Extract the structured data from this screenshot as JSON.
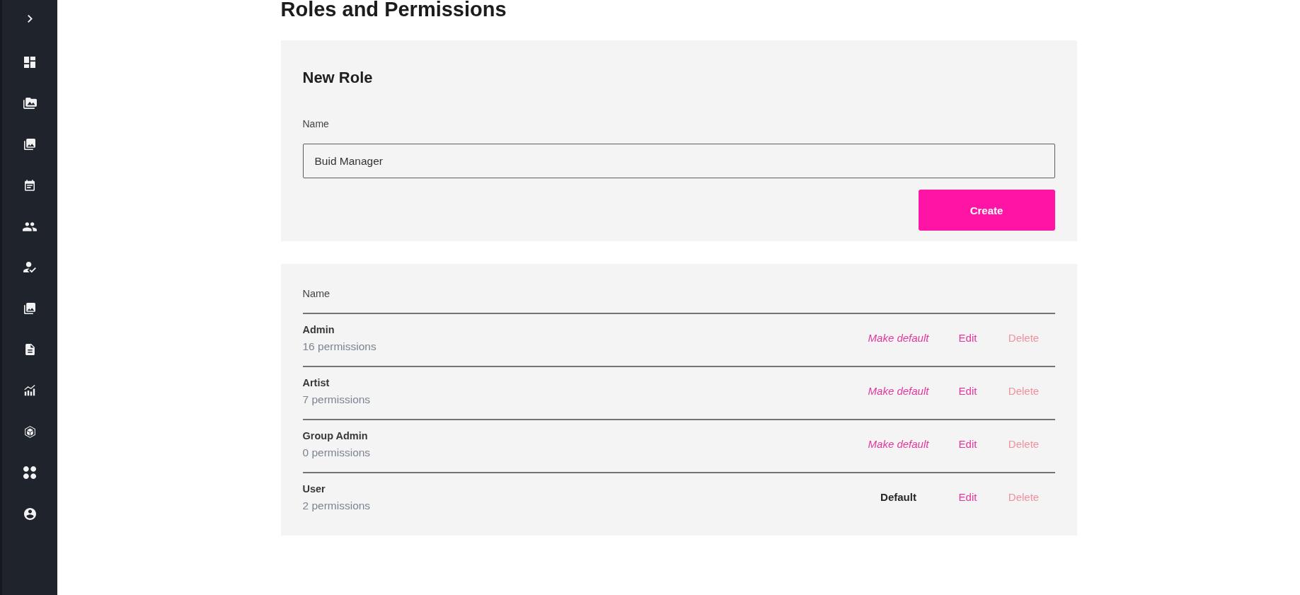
{
  "page": {
    "title": "Roles and Permissions"
  },
  "new_role": {
    "title": "New Role",
    "name_label": "Name",
    "name_value": "Buid Manager",
    "create_button": "Create"
  },
  "roles_table": {
    "columns": [
      "Name"
    ],
    "rows": [
      {
        "name": "Admin",
        "permissions": "16 permissions",
        "default": false,
        "default_text": "Make default",
        "actions": [
          {
            "kind": "edit",
            "label": "Edit"
          },
          {
            "kind": "delete",
            "label": "Delete"
          }
        ]
      },
      {
        "name": "Artist",
        "permissions": "7 permissions",
        "default": false,
        "default_text": "Make default",
        "actions": [
          {
            "kind": "edit",
            "label": "Edit"
          },
          {
            "kind": "delete",
            "label": "Delete"
          }
        ]
      },
      {
        "name": "Group Admin",
        "permissions": "0 permissions",
        "default": false,
        "default_text": "Make default",
        "actions": [
          {
            "kind": "edit",
            "label": "Edit"
          },
          {
            "kind": "delete",
            "label": "Delete"
          }
        ]
      },
      {
        "name": "User",
        "permissions": "2 permissions",
        "default": true,
        "default_text": "Default",
        "actions": [
          {
            "kind": "edit",
            "label": "Edit"
          },
          {
            "kind": "delete",
            "label": "Delete"
          }
        ]
      }
    ]
  }
}
